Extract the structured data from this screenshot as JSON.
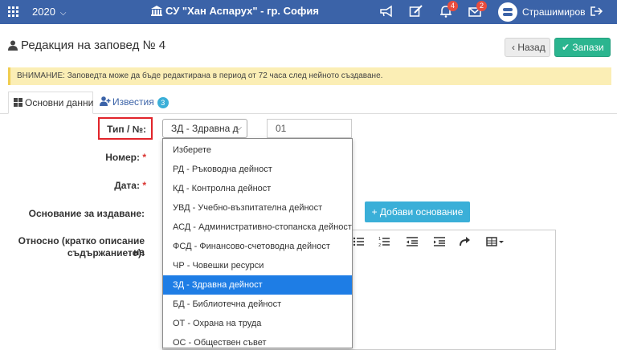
{
  "topbar": {
    "year": "2020",
    "school": "СУ \"Хан Аспарух\" - гр. София",
    "notifications_count": "4",
    "messages_count": "2",
    "username": "Страшимиров",
    "icons": [
      "apps-grid-icon",
      "bullhorn-icon",
      "edit-icon",
      "bell-icon",
      "envelope-icon",
      "logout-icon"
    ]
  },
  "header": {
    "title": "Редакция на заповед № 4",
    "back_label": "Назад",
    "save_label": "Запази"
  },
  "alert": {
    "text": "ВНИМАНИЕ: Заповедта може да бъде редактирана в период от 72 часа след нейното създаване."
  },
  "tabs": {
    "main": "Основни данни",
    "news": "Известия",
    "news_count": "3"
  },
  "form": {
    "type_label": "Тип / №:",
    "type_value": "ЗД - Здравна д",
    "number_value": "01",
    "number_label": "Номер:",
    "date_label": "Дата:",
    "basis_label": "Основание за издаване:",
    "add_basis_label": "+ Добави основание",
    "about_label_1": "Относно (кратко описание на",
    "about_label_2": "съдържанието):",
    "required_mark": "*"
  },
  "dropdown": {
    "options": [
      "Изберете",
      "РД - Ръководна дейност",
      "КД - Контролна дейност",
      "УВД - Учебно-възпитателна дейност",
      "АСД - Административно-стопанска дейност",
      "ФСД - Финансово-счетоводна дейност",
      "ЧР - Човешки ресурси",
      "ЗД - Здравна дейност",
      "БД - Библиотечна дейност",
      "ОТ - Охрана на труда",
      "ОС - Обществен съвет"
    ],
    "selected": "ЗД - Здравна дейност"
  },
  "colors": {
    "topbar": "#3b63a8",
    "save": "#2bb58f",
    "info": "#3aafd8",
    "highlight": "#1e7de5",
    "alert_bg": "#fbeeb5",
    "annotation": "#e1242a"
  }
}
